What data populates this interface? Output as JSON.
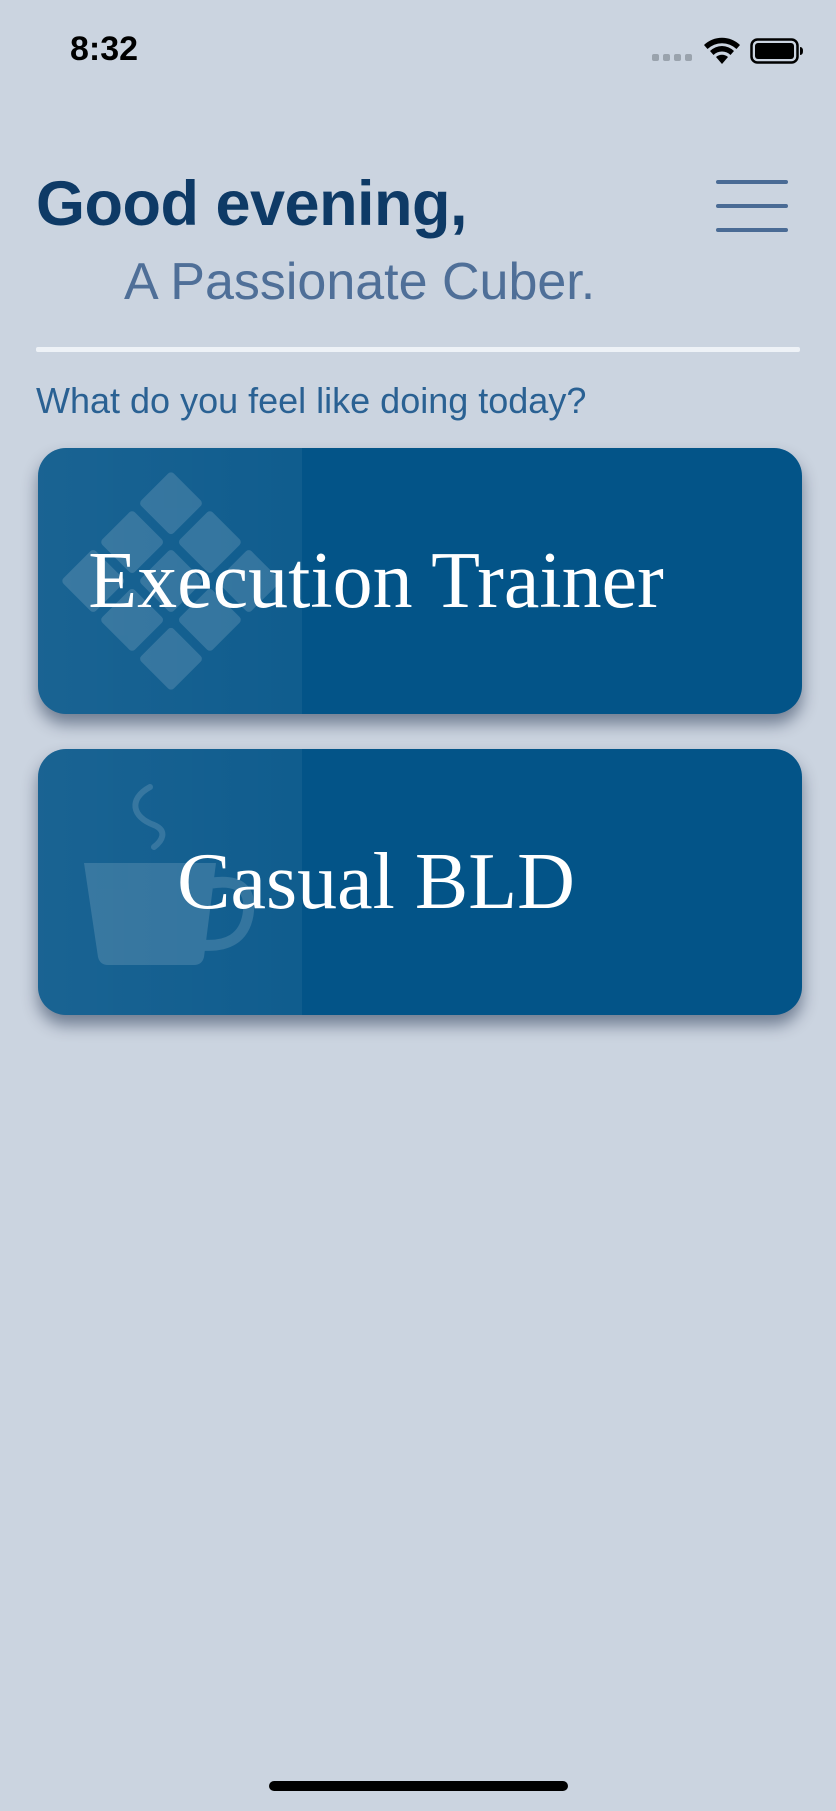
{
  "status_bar": {
    "time": "8:32",
    "signal_icon": "cellular-signal-icon",
    "wifi_icon": "wifi-icon",
    "battery_icon": "battery-icon"
  },
  "header": {
    "greeting": "Good evening,",
    "username": "A Passionate Cuber.",
    "menu_icon": "hamburger-menu-icon"
  },
  "prompt": "What do you feel like doing today?",
  "cards": [
    {
      "label": "Execution Trainer",
      "icon": "cube-face-icon"
    },
    {
      "label": "Casual BLD",
      "icon": "coffee-cup-icon"
    }
  ],
  "colors": {
    "background": "#cbd4e0",
    "card": "#035488",
    "greeting": "#0e3a66",
    "username": "#4f6f98",
    "prompt": "#2a6193"
  }
}
